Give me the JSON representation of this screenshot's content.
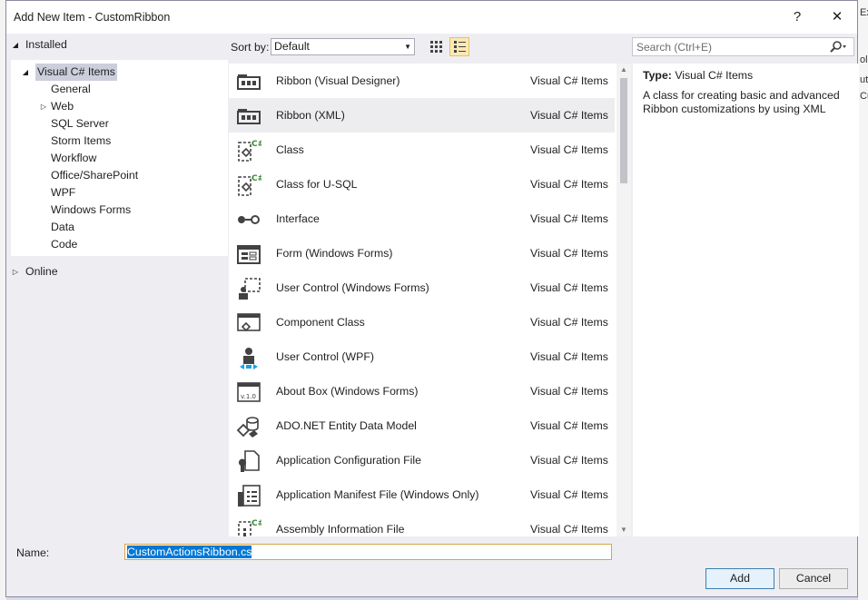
{
  "window": {
    "title": "Add New Item - CustomRibbon",
    "help": "?",
    "close": "✕"
  },
  "tree": {
    "installed": "Installed",
    "root": "Visual C# Items",
    "children": [
      "General",
      "Web",
      "SQL Server",
      "Storm Items",
      "Workflow",
      "Office/SharePoint",
      "WPF",
      "Windows Forms",
      "Data",
      "Code"
    ],
    "online": "Online"
  },
  "toolbar": {
    "sort_label": "Sort by:",
    "sort_value": "Default"
  },
  "search": {
    "placeholder": "Search (Ctrl+E)"
  },
  "items": [
    {
      "name": "Ribbon (Visual Designer)",
      "category": "Visual C# Items",
      "icon": "ribbon-designer-icon"
    },
    {
      "name": "Ribbon (XML)",
      "category": "Visual C# Items",
      "icon": "ribbon-xml-icon"
    },
    {
      "name": "Class",
      "category": "Visual C# Items",
      "icon": "class-icon"
    },
    {
      "name": "Class for U-SQL",
      "category": "Visual C# Items",
      "icon": "class-usql-icon"
    },
    {
      "name": "Interface",
      "category": "Visual C# Items",
      "icon": "interface-icon"
    },
    {
      "name": "Form (Windows Forms)",
      "category": "Visual C# Items",
      "icon": "form-icon"
    },
    {
      "name": "User Control (Windows Forms)",
      "category": "Visual C# Items",
      "icon": "user-control-icon"
    },
    {
      "name": "Component Class",
      "category": "Visual C# Items",
      "icon": "component-class-icon"
    },
    {
      "name": "User Control (WPF)",
      "category": "Visual C# Items",
      "icon": "user-control-wpf-icon"
    },
    {
      "name": "About Box (Windows Forms)",
      "category": "Visual C# Items",
      "icon": "about-box-icon"
    },
    {
      "name": "ADO.NET Entity Data Model",
      "category": "Visual C# Items",
      "icon": "entity-model-icon"
    },
    {
      "name": "Application Configuration File",
      "category": "Visual C# Items",
      "icon": "config-file-icon"
    },
    {
      "name": "Application Manifest File (Windows Only)",
      "category": "Visual C# Items",
      "icon": "manifest-file-icon"
    },
    {
      "name": "Assembly Information File",
      "category": "Visual C# Items",
      "icon": "assembly-info-icon"
    }
  ],
  "selected_index": 1,
  "details": {
    "type_label": "Type:",
    "type_value": "Visual C# Items",
    "description": "A class for creating basic and advanced Ribbon customizations by using XML"
  },
  "name_field": {
    "label": "Name:",
    "value": "CustomActionsRibbon.cs"
  },
  "buttons": {
    "add": "Add",
    "cancel": "Cancel"
  },
  "background_fragments": [
    "Ex",
    "ol",
    "ut",
    "Cu"
  ]
}
